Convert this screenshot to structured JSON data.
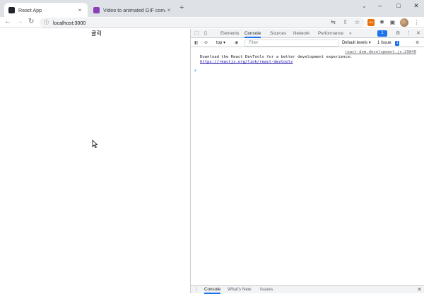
{
  "browser": {
    "tabs": [
      {
        "title": "React App",
        "close": "×",
        "favicon_color": "#20232a"
      },
      {
        "title": "Video to animated GIF converter",
        "close": "×",
        "favicon_color": "#8b3fb7"
      }
    ],
    "new_tab": "+",
    "window": {
      "dropdown": "⌄",
      "minimize": "–",
      "maximize": "□",
      "close": "✕"
    },
    "nav": {
      "back": "←",
      "forward": "→",
      "reload": "↻"
    },
    "address": "localhost:3000",
    "address_info_icon": "ⓘ",
    "toolbar_icons": {
      "translate": "⇆",
      "share": "⇪",
      "bookmark": "☆",
      "extension": "GA",
      "puzzle": "✱",
      "sidepanel": "▣",
      "menu": "⋮"
    }
  },
  "page": {
    "click_text": "클릭"
  },
  "devtools": {
    "tabs": [
      "Elements",
      "Console",
      "Sources",
      "Network",
      "Performance"
    ],
    "active_tab": "Console",
    "more_tabs": "»",
    "issue_count": "1",
    "top_icons": {
      "inspect": "⬚",
      "device": "▯",
      "settings": "⚙",
      "menu": "⋮",
      "close": "✕"
    },
    "console_toolbar": {
      "sidebar_icon": "◧",
      "clear_icon": "⊘",
      "context": "top",
      "context_arrow": "▾",
      "eye_icon": "◉",
      "filter_placeholder": "Filter",
      "levels": "Default levels",
      "levels_arrow": "▾",
      "issues_label": "1 Issue:",
      "issues_count": "1",
      "settings_icon": "⚙"
    },
    "console": {
      "source": "react-dom.development.js:29840",
      "message": "Download the React DevTools for a better development experience: ",
      "link": "https://reactjs.org/link/react-devtools",
      "prompt": "›"
    },
    "drawer": {
      "menu": "⋮",
      "tabs": [
        "Console",
        "What's New",
        "Issues"
      ],
      "active": "Console",
      "close": "✕"
    }
  },
  "colors": {
    "accent": "#1a73e8",
    "tab_strip": "#dee1e6",
    "devtools_bg": "#f1f3f4",
    "link": "#1a0dab"
  }
}
